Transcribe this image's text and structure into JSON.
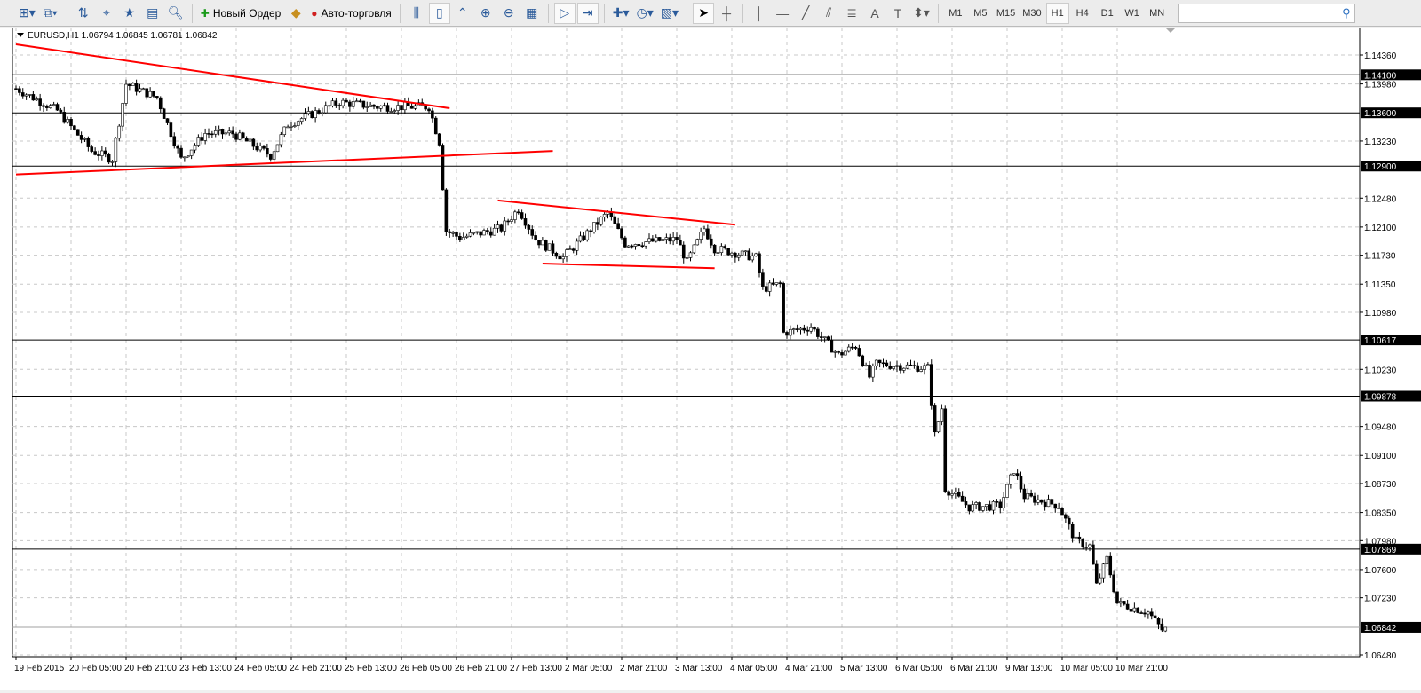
{
  "toolbar": {
    "new_order": "Новый Ордер",
    "autotrading": "Авто-торговля",
    "timeframes": [
      "M1",
      "M5",
      "M15",
      "M30",
      "H1",
      "H4",
      "D1",
      "W1",
      "MN"
    ],
    "active_timeframe": "H1",
    "search_placeholder": ""
  },
  "chart": {
    "header": "EURUSD,H1  1.06794 1.06845 1.06781 1.06842"
  },
  "chart_data": {
    "type": "candlestick",
    "symbol": "EURUSD",
    "timeframe": "H1",
    "ohlc_last": [
      1.06794,
      1.06845,
      1.06781,
      1.06842
    ],
    "ylim": [
      1.0648,
      1.1436
    ],
    "price_ticks": [
      "1.14360",
      "1.13980",
      "1.13230",
      "1.12480",
      "1.12100",
      "1.11730",
      "1.11350",
      "1.10980",
      "1.10230",
      "1.09480",
      "1.09100",
      "1.08730",
      "1.08350",
      "1.07980",
      "1.07600",
      "1.07230",
      "1.06480"
    ],
    "time_labels": [
      "19 Feb 2015",
      "20 Feb 05:00",
      "20 Feb 21:00",
      "23 Feb 13:00",
      "24 Feb 05:00",
      "24 Feb 21:00",
      "25 Feb 13:00",
      "26 Feb 05:00",
      "26 Feb 21:00",
      "27 Feb 13:00",
      "2 Mar 05:00",
      "2 Mar 21:00",
      "3 Mar 13:00",
      "4 Mar 05:00",
      "4 Mar 21:00",
      "5 Mar 13:00",
      "6 Mar 05:00",
      "6 Mar 21:00",
      "9 Mar 13:00",
      "10 Mar 05:00",
      "10 Mar 21:00"
    ],
    "bars_per_label": 16,
    "total_bars": 335,
    "close_path": [
      [
        0,
        1.1392
      ],
      [
        12,
        1.1363
      ],
      [
        22,
        1.131
      ],
      [
        28,
        1.1299
      ],
      [
        32,
        1.1398
      ],
      [
        41,
        1.138
      ],
      [
        48,
        1.1299
      ],
      [
        55,
        1.1333
      ],
      [
        63,
        1.1333
      ],
      [
        74,
        1.1304
      ],
      [
        79,
        1.1345
      ],
      [
        94,
        1.1374
      ],
      [
        105,
        1.1368
      ],
      [
        120,
        1.1368
      ],
      [
        123,
        1.1322
      ],
      [
        125,
        1.1205
      ],
      [
        129,
        1.1196
      ],
      [
        141,
        1.1208
      ],
      [
        146,
        1.1234
      ],
      [
        151,
        1.1194
      ],
      [
        159,
        1.117
      ],
      [
        172,
        1.1229
      ],
      [
        177,
        1.1188
      ],
      [
        192,
        1.1194
      ],
      [
        195,
        1.1164
      ],
      [
        200,
        1.1208
      ],
      [
        203,
        1.1182
      ],
      [
        215,
        1.117
      ],
      [
        217,
        1.1129
      ],
      [
        222,
        1.1135
      ],
      [
        223,
        1.1071
      ],
      [
        231,
        1.1079
      ],
      [
        239,
        1.1042
      ],
      [
        244,
        1.1054
      ],
      [
        248,
        1.1013
      ],
      [
        250,
        1.103
      ],
      [
        265,
        1.1025
      ],
      [
        267,
        1.0937
      ],
      [
        269,
        1.0972
      ],
      [
        270,
        1.0867
      ],
      [
        277,
        1.0842
      ],
      [
        286,
        1.0844
      ],
      [
        290,
        1.0891
      ],
      [
        293,
        1.0856
      ],
      [
        303,
        1.0844
      ],
      [
        308,
        1.0797
      ],
      [
        312,
        1.0791
      ],
      [
        314,
        1.0739
      ],
      [
        317,
        1.0774
      ],
      [
        320,
        1.0716
      ],
      [
        329,
        1.0704
      ],
      [
        333,
        1.0681
      ],
      [
        334,
        1.06842
      ]
    ],
    "horizontal_levels": [
      {
        "price": "1.14100"
      },
      {
        "price": "1.13600"
      },
      {
        "price": "1.12900"
      },
      {
        "price": "1.10617"
      },
      {
        "price": "1.09878"
      },
      {
        "price": "1.07869"
      },
      {
        "price": "1.06842",
        "current": true
      }
    ],
    "trend_lines": [
      [
        [
          0,
          1.145
        ],
        [
          126,
          1.1366
        ]
      ],
      [
        [
          0,
          1.1279
        ],
        [
          156,
          1.131
        ]
      ],
      [
        [
          140,
          1.1245
        ],
        [
          209,
          1.1213
        ]
      ],
      [
        [
          153,
          1.1162
        ],
        [
          203,
          1.1156
        ]
      ]
    ],
    "colors": {
      "trend": "#ff0000",
      "candle": "#000000",
      "grid": "#c0c0c0",
      "level": "#000000"
    }
  }
}
